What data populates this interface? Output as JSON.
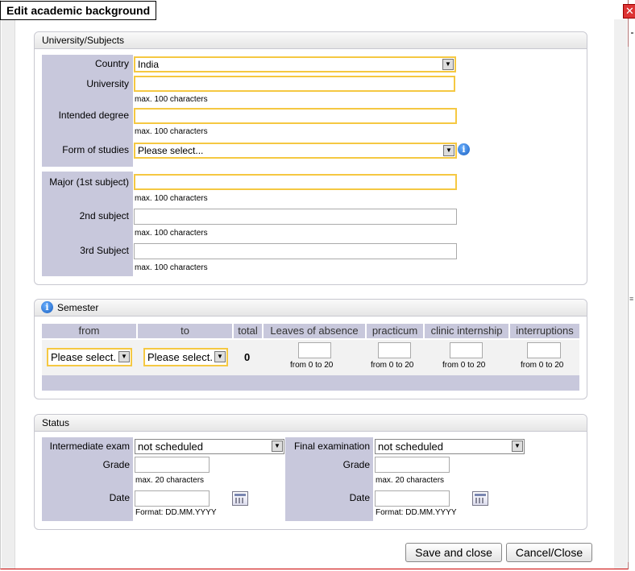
{
  "dialog": {
    "title": "Edit academic background",
    "close_label": "✕"
  },
  "university": {
    "legend": "University/Subjects",
    "country_label": "Country",
    "country_value": "India",
    "university_label": "University",
    "degree_label": "Intended degree",
    "form_label": "Form of studies",
    "form_value": "Please select...",
    "major_label": "Major (1st subject)",
    "second_label": "2nd subject",
    "third_label": "3rd Subject",
    "hint_100": "max. 100 characters"
  },
  "semester": {
    "legend": "Semester",
    "columns": [
      "from",
      "to",
      "total",
      "Leaves of absence",
      "practicum",
      "clinic internship",
      "interruptions"
    ],
    "from_value": "Please select.",
    "to_value": "Please select.",
    "total_value": "0",
    "range_hint": "from 0 to 20"
  },
  "status": {
    "legend": "Status",
    "intermediate_label": "Intermediate exam",
    "intermediate_value": "not scheduled",
    "final_label": "Final examination",
    "final_value": "not scheduled",
    "grade_label": "Grade",
    "grade_hint": "max. 20 characters",
    "date_label": "Date",
    "date_hint": "Format: DD.MM.YYYY"
  },
  "buttons": {
    "save": "Save and close",
    "cancel": "Cancel/Close"
  },
  "colors": {
    "label_bg": "#c8c8dc",
    "highlight_border": "#f5c842",
    "close_red": "#dd3333"
  }
}
